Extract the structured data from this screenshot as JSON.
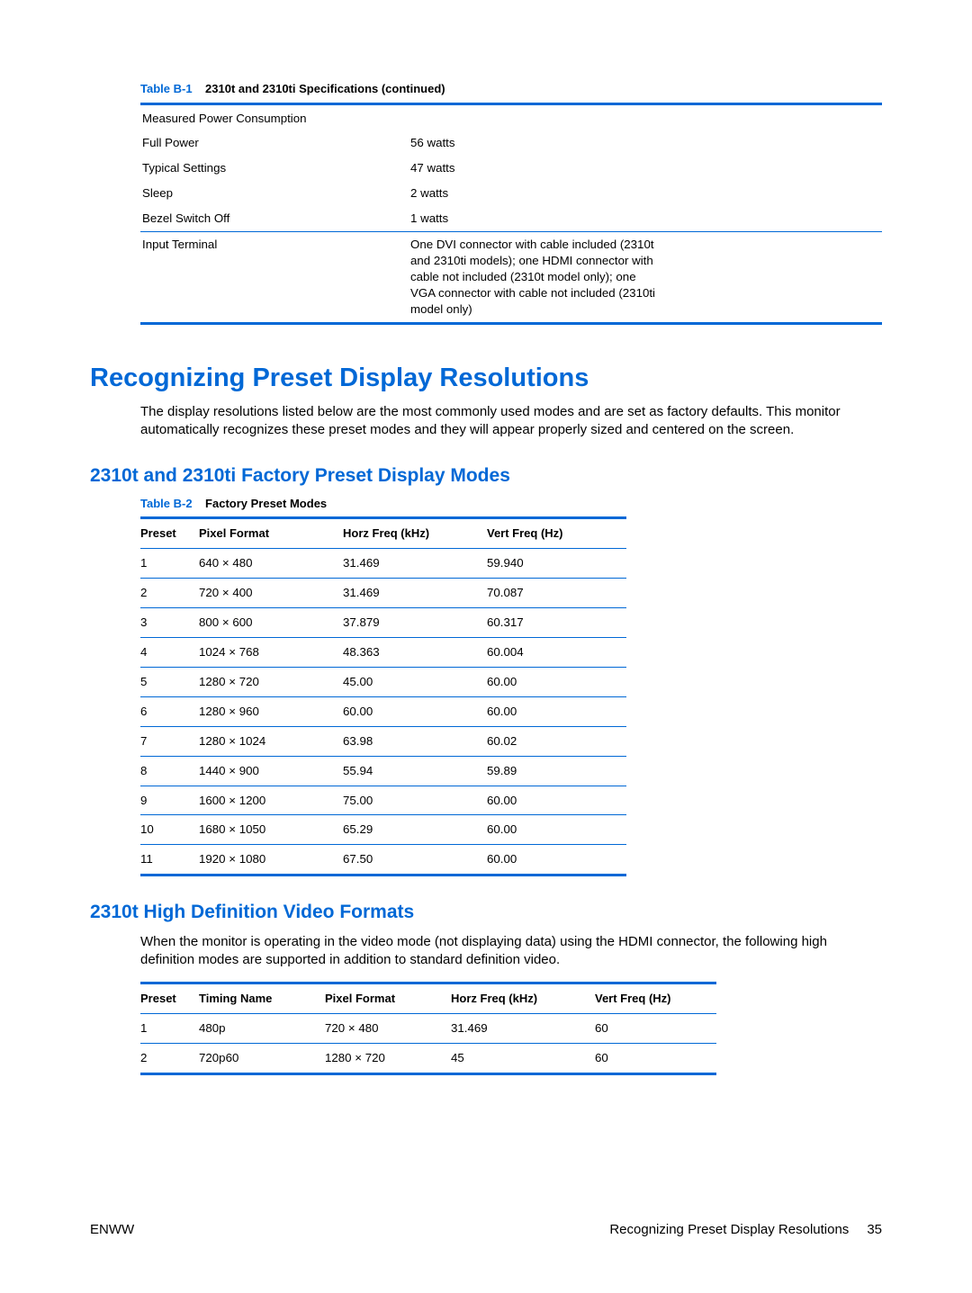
{
  "tableB1": {
    "caption_prefix": "Table B-1",
    "caption_text": "2310t and 2310ti Specifications (continued)",
    "section_header": "Measured Power Consumption",
    "rows": [
      {
        "label": "Full Power",
        "value": "56 watts"
      },
      {
        "label": "Typical Settings",
        "value": "47 watts"
      },
      {
        "label": "Sleep",
        "value": "2 watts"
      },
      {
        "label": "Bezel Switch Off",
        "value": "1 watts"
      }
    ],
    "input_terminal_label": "Input Terminal",
    "input_terminal_value": "One DVI connector with cable included (2310t and 2310ti models); one HDMI connector with cable not included (2310t model only); one VGA connector with cable not included (2310ti model only)"
  },
  "h1": "Recognizing Preset Display Resolutions",
  "intro": "The display resolutions listed below are the most commonly used modes and are set as factory defaults. This monitor automatically recognizes these preset modes and they will appear properly sized and centered on the screen.",
  "h2a": "2310t and 2310ti Factory Preset Display Modes",
  "tableB2": {
    "caption_prefix": "Table B-2",
    "caption_text": "Factory Preset Modes",
    "headers": [
      "Preset",
      "Pixel Format",
      "Horz Freq (kHz)",
      "Vert Freq (Hz)"
    ],
    "rows": [
      [
        "1",
        "640 × 480",
        "31.469",
        "59.940"
      ],
      [
        "2",
        "720 × 400",
        "31.469",
        "70.087"
      ],
      [
        "3",
        "800 × 600",
        "37.879",
        "60.317"
      ],
      [
        "4",
        "1024 × 768",
        "48.363",
        "60.004"
      ],
      [
        "5",
        "1280 × 720",
        "45.00",
        "60.00"
      ],
      [
        "6",
        "1280 × 960",
        "60.00",
        "60.00"
      ],
      [
        "7",
        "1280 × 1024",
        "63.98",
        "60.02"
      ],
      [
        "8",
        "1440 × 900",
        "55.94",
        "59.89"
      ],
      [
        "9",
        "1600 × 1200",
        "75.00",
        "60.00"
      ],
      [
        "10",
        "1680 × 1050",
        "65.29",
        "60.00"
      ],
      [
        "11",
        "1920 × 1080",
        "67.50",
        "60.00"
      ]
    ]
  },
  "h2b": "2310t High Definition Video Formats",
  "hd_intro": "When the monitor is operating in the video mode (not displaying data) using the HDMI connector, the following high definition modes are supported in addition to standard definition video.",
  "tableHD": {
    "headers": [
      "Preset",
      "Timing Name",
      "Pixel Format",
      "Horz Freq (kHz)",
      "Vert Freq (Hz)"
    ],
    "rows": [
      [
        "1",
        "480p",
        "720 × 480",
        "31.469",
        "60"
      ],
      [
        "2",
        "720p60",
        "1280 × 720",
        "45",
        "60"
      ]
    ]
  },
  "footer": {
    "left": "ENWW",
    "right_text": "Recognizing Preset Display Resolutions",
    "page": "35"
  }
}
